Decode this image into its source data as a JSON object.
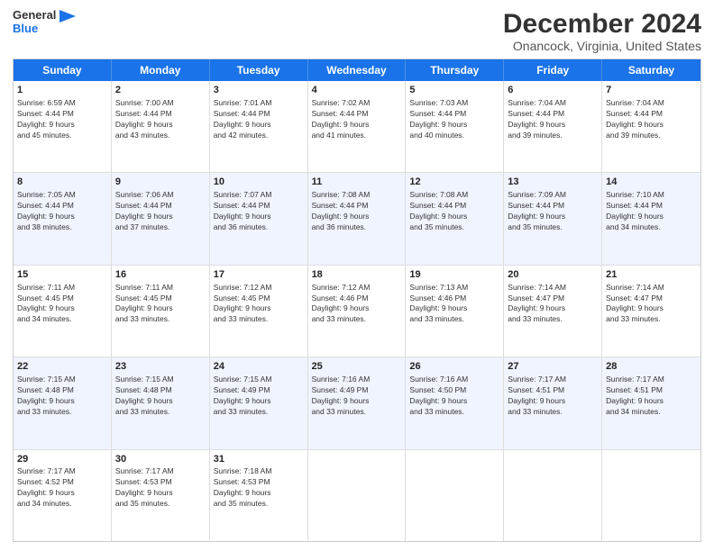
{
  "logo": {
    "line1": "General",
    "line2": "Blue"
  },
  "title": "December 2024",
  "subtitle": "Onancock, Virginia, United States",
  "header_days": [
    "Sunday",
    "Monday",
    "Tuesday",
    "Wednesday",
    "Thursday",
    "Friday",
    "Saturday"
  ],
  "weeks": [
    [
      {
        "day": "1",
        "lines": [
          "Sunrise: 6:59 AM",
          "Sunset: 4:44 PM",
          "Daylight: 9 hours",
          "and 45 minutes."
        ]
      },
      {
        "day": "2",
        "lines": [
          "Sunrise: 7:00 AM",
          "Sunset: 4:44 PM",
          "Daylight: 9 hours",
          "and 43 minutes."
        ]
      },
      {
        "day": "3",
        "lines": [
          "Sunrise: 7:01 AM",
          "Sunset: 4:44 PM",
          "Daylight: 9 hours",
          "and 42 minutes."
        ]
      },
      {
        "day": "4",
        "lines": [
          "Sunrise: 7:02 AM",
          "Sunset: 4:44 PM",
          "Daylight: 9 hours",
          "and 41 minutes."
        ]
      },
      {
        "day": "5",
        "lines": [
          "Sunrise: 7:03 AM",
          "Sunset: 4:44 PM",
          "Daylight: 9 hours",
          "and 40 minutes."
        ]
      },
      {
        "day": "6",
        "lines": [
          "Sunrise: 7:04 AM",
          "Sunset: 4:44 PM",
          "Daylight: 9 hours",
          "and 39 minutes."
        ]
      },
      {
        "day": "7",
        "lines": [
          "Sunrise: 7:04 AM",
          "Sunset: 4:44 PM",
          "Daylight: 9 hours",
          "and 39 minutes."
        ]
      }
    ],
    [
      {
        "day": "8",
        "lines": [
          "Sunrise: 7:05 AM",
          "Sunset: 4:44 PM",
          "Daylight: 9 hours",
          "and 38 minutes."
        ]
      },
      {
        "day": "9",
        "lines": [
          "Sunrise: 7:06 AM",
          "Sunset: 4:44 PM",
          "Daylight: 9 hours",
          "and 37 minutes."
        ]
      },
      {
        "day": "10",
        "lines": [
          "Sunrise: 7:07 AM",
          "Sunset: 4:44 PM",
          "Daylight: 9 hours",
          "and 36 minutes."
        ]
      },
      {
        "day": "11",
        "lines": [
          "Sunrise: 7:08 AM",
          "Sunset: 4:44 PM",
          "Daylight: 9 hours",
          "and 36 minutes."
        ]
      },
      {
        "day": "12",
        "lines": [
          "Sunrise: 7:08 AM",
          "Sunset: 4:44 PM",
          "Daylight: 9 hours",
          "and 35 minutes."
        ]
      },
      {
        "day": "13",
        "lines": [
          "Sunrise: 7:09 AM",
          "Sunset: 4:44 PM",
          "Daylight: 9 hours",
          "and 35 minutes."
        ]
      },
      {
        "day": "14",
        "lines": [
          "Sunrise: 7:10 AM",
          "Sunset: 4:44 PM",
          "Daylight: 9 hours",
          "and 34 minutes."
        ]
      }
    ],
    [
      {
        "day": "15",
        "lines": [
          "Sunrise: 7:11 AM",
          "Sunset: 4:45 PM",
          "Daylight: 9 hours",
          "and 34 minutes."
        ]
      },
      {
        "day": "16",
        "lines": [
          "Sunrise: 7:11 AM",
          "Sunset: 4:45 PM",
          "Daylight: 9 hours",
          "and 33 minutes."
        ]
      },
      {
        "day": "17",
        "lines": [
          "Sunrise: 7:12 AM",
          "Sunset: 4:45 PM",
          "Daylight: 9 hours",
          "and 33 minutes."
        ]
      },
      {
        "day": "18",
        "lines": [
          "Sunrise: 7:12 AM",
          "Sunset: 4:46 PM",
          "Daylight: 9 hours",
          "and 33 minutes."
        ]
      },
      {
        "day": "19",
        "lines": [
          "Sunrise: 7:13 AM",
          "Sunset: 4:46 PM",
          "Daylight: 9 hours",
          "and 33 minutes."
        ]
      },
      {
        "day": "20",
        "lines": [
          "Sunrise: 7:14 AM",
          "Sunset: 4:47 PM",
          "Daylight: 9 hours",
          "and 33 minutes."
        ]
      },
      {
        "day": "21",
        "lines": [
          "Sunrise: 7:14 AM",
          "Sunset: 4:47 PM",
          "Daylight: 9 hours",
          "and 33 minutes."
        ]
      }
    ],
    [
      {
        "day": "22",
        "lines": [
          "Sunrise: 7:15 AM",
          "Sunset: 4:48 PM",
          "Daylight: 9 hours",
          "and 33 minutes."
        ]
      },
      {
        "day": "23",
        "lines": [
          "Sunrise: 7:15 AM",
          "Sunset: 4:48 PM",
          "Daylight: 9 hours",
          "and 33 minutes."
        ]
      },
      {
        "day": "24",
        "lines": [
          "Sunrise: 7:15 AM",
          "Sunset: 4:49 PM",
          "Daylight: 9 hours",
          "and 33 minutes."
        ]
      },
      {
        "day": "25",
        "lines": [
          "Sunrise: 7:16 AM",
          "Sunset: 4:49 PM",
          "Daylight: 9 hours",
          "and 33 minutes."
        ]
      },
      {
        "day": "26",
        "lines": [
          "Sunrise: 7:16 AM",
          "Sunset: 4:50 PM",
          "Daylight: 9 hours",
          "and 33 minutes."
        ]
      },
      {
        "day": "27",
        "lines": [
          "Sunrise: 7:17 AM",
          "Sunset: 4:51 PM",
          "Daylight: 9 hours",
          "and 33 minutes."
        ]
      },
      {
        "day": "28",
        "lines": [
          "Sunrise: 7:17 AM",
          "Sunset: 4:51 PM",
          "Daylight: 9 hours",
          "and 34 minutes."
        ]
      }
    ],
    [
      {
        "day": "29",
        "lines": [
          "Sunrise: 7:17 AM",
          "Sunset: 4:52 PM",
          "Daylight: 9 hours",
          "and 34 minutes."
        ]
      },
      {
        "day": "30",
        "lines": [
          "Sunrise: 7:17 AM",
          "Sunset: 4:53 PM",
          "Daylight: 9 hours",
          "and 35 minutes."
        ]
      },
      {
        "day": "31",
        "lines": [
          "Sunrise: 7:18 AM",
          "Sunset: 4:53 PM",
          "Daylight: 9 hours",
          "and 35 minutes."
        ]
      },
      {
        "day": "",
        "lines": []
      },
      {
        "day": "",
        "lines": []
      },
      {
        "day": "",
        "lines": []
      },
      {
        "day": "",
        "lines": []
      }
    ]
  ]
}
